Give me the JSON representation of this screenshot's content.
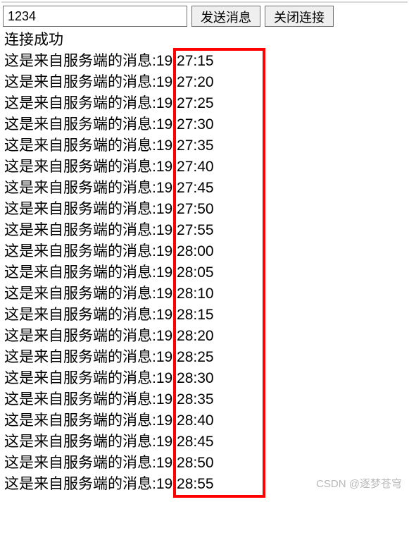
{
  "controls": {
    "input_value": "1234",
    "send_button_label": "发送消息",
    "close_button_label": "关闭连接"
  },
  "status": "连接成功",
  "message_prefix": "这是来自服务端的消息: ",
  "messages": [
    {
      "time": "19:27:15"
    },
    {
      "time": "19:27:20"
    },
    {
      "time": "19:27:25"
    },
    {
      "time": "19:27:30"
    },
    {
      "time": "19:27:35"
    },
    {
      "time": "19:27:40"
    },
    {
      "time": "19:27:45"
    },
    {
      "time": "19:27:50"
    },
    {
      "time": "19:27:55"
    },
    {
      "time": "19:28:00"
    },
    {
      "time": "19:28:05"
    },
    {
      "time": "19:28:10"
    },
    {
      "time": "19:28:15"
    },
    {
      "time": "19:28:20"
    },
    {
      "time": "19:28:25"
    },
    {
      "time": "19:28:30"
    },
    {
      "time": "19:28:35"
    },
    {
      "time": "19:28:40"
    },
    {
      "time": "19:28:45"
    },
    {
      "time": "19:28:50"
    },
    {
      "time": "19:28:55"
    }
  ],
  "watermark": "CSDN @逐梦苍穹"
}
